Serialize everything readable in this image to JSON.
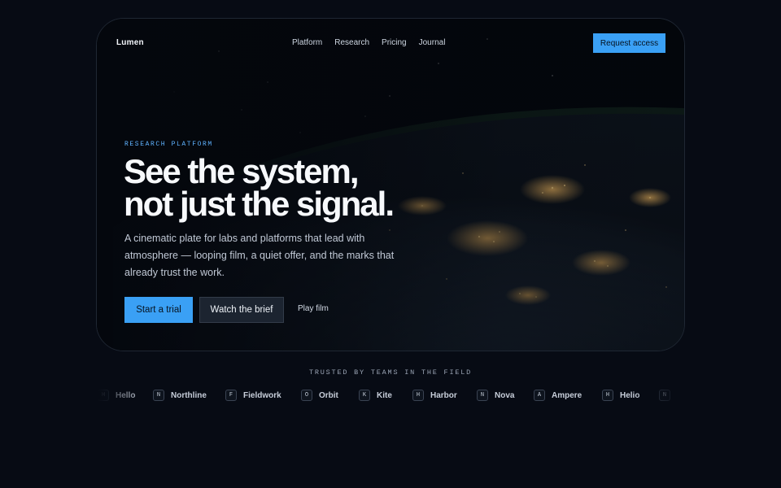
{
  "brand": "Lumen",
  "nav": {
    "links": [
      "Platform",
      "Research",
      "Pricing",
      "Journal"
    ],
    "cta_label": "Request access"
  },
  "hero": {
    "eyebrow": "RESEARCH PLATFORM",
    "headline_line1": "See the system,",
    "headline_line2": "not just the signal.",
    "subcopy": "A cinematic plate for labs and platforms that lead with atmosphere — looping film, a quiet offer, and the marks that already trust the work.",
    "primary_label": "Start a trial",
    "secondary_label": "Watch the brief",
    "ghost_label": "Play film"
  },
  "trusted": {
    "heading": "TRUSTED BY TEAMS IN THE FIELD",
    "logos": [
      {
        "badge": "H",
        "name": "Hello"
      },
      {
        "badge": "N",
        "name": "Northline"
      },
      {
        "badge": "F",
        "name": "Fieldwork"
      },
      {
        "badge": "O",
        "name": "Orbit"
      },
      {
        "badge": "K",
        "name": "Kite"
      },
      {
        "badge": "H",
        "name": "Harbor"
      },
      {
        "badge": "N",
        "name": "Nova"
      },
      {
        "badge": "A",
        "name": "Ampere"
      },
      {
        "badge": "H",
        "name": "Helio"
      },
      {
        "badge": "N",
        "name": ""
      }
    ]
  },
  "colors": {
    "background": "#070b14",
    "accent": "#3aa0f5",
    "eyebrow": "#5fb2ff"
  }
}
